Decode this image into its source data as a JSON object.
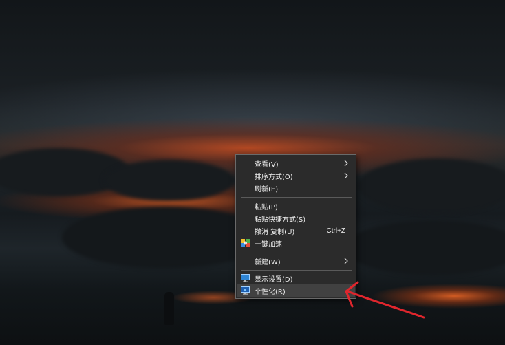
{
  "context_menu": {
    "items": [
      {
        "label": "查看(V)",
        "submenu": true
      },
      {
        "label": "排序方式(O)",
        "submenu": true
      },
      {
        "label": "刷新(E)"
      },
      {
        "label": "粘贴(P)"
      },
      {
        "label": "粘贴快捷方式(S)"
      },
      {
        "label": "撤消 复制(U)",
        "shortcut": "Ctrl+Z"
      },
      {
        "label": "一键加速",
        "icon": "speed-boost-icon"
      },
      {
        "label": "新建(W)",
        "submenu": true
      },
      {
        "label": "显示设置(D)",
        "icon": "monitor-icon"
      },
      {
        "label": "个性化(R)",
        "icon": "personalize-icon",
        "highlighted": true
      }
    ]
  },
  "colors": {
    "menu_background": "#2b2b2b",
    "menu_text": "#f0f0f0",
    "highlight": "#414141",
    "annotation_arrow": "#e0262d"
  }
}
